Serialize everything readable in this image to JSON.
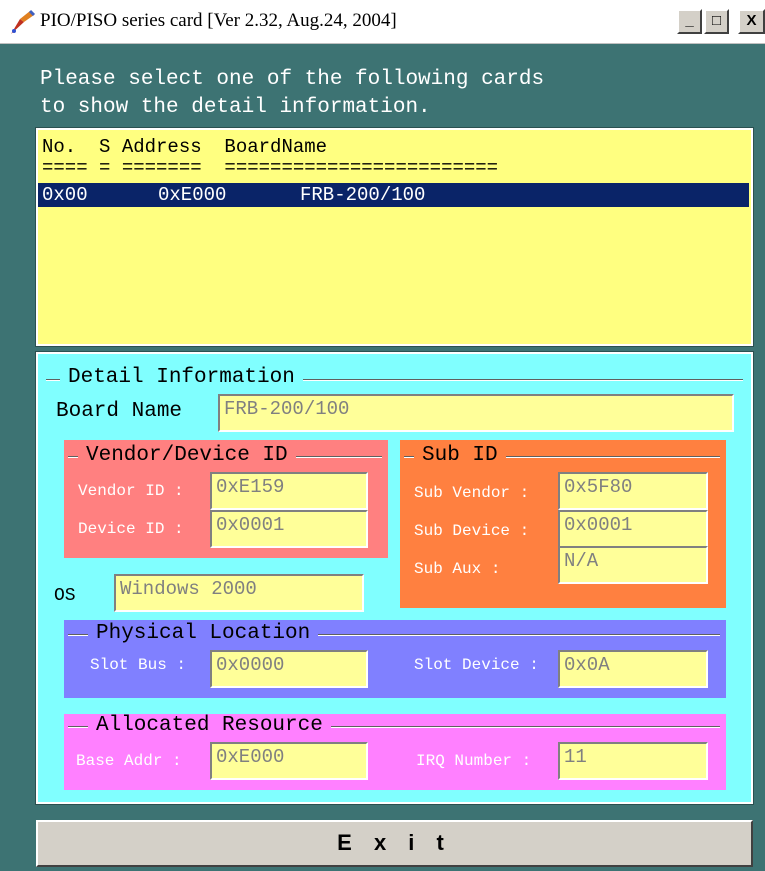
{
  "window": {
    "title": "PIO/PISO series card [Ver 2.32, Aug.24, 2004]",
    "min_label": "_",
    "max_label": "□",
    "close_label": "X"
  },
  "prompt": {
    "line1": "Please select one of the following cards",
    "line2": "to show the detail information."
  },
  "card_list": {
    "header": "No.  S Address  BoardName",
    "separator": "==== = =======  ========================",
    "rows": [
      {
        "no": "0x00",
        "address": "0xE000",
        "board_name": "FRB-200/100"
      }
    ]
  },
  "detail": {
    "legend": "Detail Information",
    "board_name_label": "Board Name",
    "board_name_value": "FRB-200/100",
    "vendor_device": {
      "legend": "Vendor/Device ID",
      "vendor_label": "Vendor ID :",
      "vendor_value": "0xE159",
      "device_label": "Device ID :",
      "device_value": "0x0001"
    },
    "sub_id": {
      "legend": "Sub ID",
      "sub_vendor_label": "Sub Vendor :",
      "sub_vendor_value": "0x5F80",
      "sub_device_label": "Sub Device :",
      "sub_device_value": "0x0001",
      "sub_aux_label": "Sub Aux :",
      "sub_aux_value": "N/A"
    },
    "os_label": "OS",
    "os_value": "Windows 2000",
    "physical": {
      "legend": "Physical Location",
      "slot_bus_label": "Slot Bus :",
      "slot_bus_value": "0x0000",
      "slot_device_label": "Slot Device :",
      "slot_device_value": "0x0A"
    },
    "resource": {
      "legend": "Allocated Resource",
      "base_addr_label": "Base Addr :",
      "base_addr_value": "0xE000",
      "irq_label": "IRQ Number :",
      "irq_value": "11"
    }
  },
  "exit_label": "E x i t",
  "colors": {
    "background": "#3d7373",
    "list_bg": "#ffff80",
    "selection": "#0a2468",
    "detail_bg": "#80ffff",
    "vendor_group": "#ff8080",
    "sub_group": "#ff8040",
    "physical_group": "#8080ff",
    "resource_group": "#ff80ff"
  }
}
